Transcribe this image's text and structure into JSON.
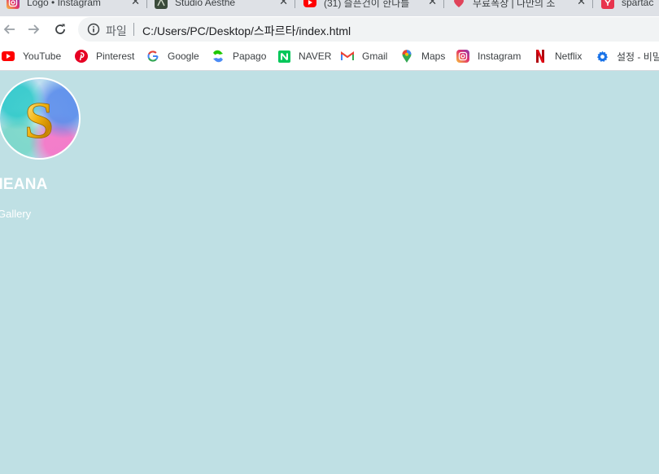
{
  "browser": {
    "tabs": [
      {
        "title": "Logo • Instagram",
        "icon": "instagram-icon"
      },
      {
        "title": "Studio Aesthe",
        "icon": "studio-aesthe-icon"
      },
      {
        "title": "(31) 슬픈건이 한다를",
        "icon": "youtube-icon"
      },
      {
        "title": "무료폭장 | 나만의 조",
        "icon": "heart-site-icon"
      },
      {
        "title": "spartac",
        "icon": "sparta-icon"
      }
    ],
    "tab_close_glyph": "✕",
    "address": {
      "label": "파일",
      "url": "C:/Users/PC/Desktop/스파르타/index.html"
    },
    "bookmarks": [
      {
        "label": "YouTube",
        "icon": "youtube-icon"
      },
      {
        "label": "Pinterest",
        "icon": "pinterest-icon"
      },
      {
        "label": "Google",
        "icon": "google-icon"
      },
      {
        "label": "Papago",
        "icon": "papago-icon"
      },
      {
        "label": "NAVER",
        "icon": "naver-icon"
      },
      {
        "label": "Gmail",
        "icon": "gmail-icon"
      },
      {
        "label": "Maps",
        "icon": "maps-icon"
      },
      {
        "label": "Instagram",
        "icon": "instagram-icon"
      },
      {
        "label": "Netflix",
        "icon": "netflix-icon"
      },
      {
        "label": "설정 - 비밀",
        "icon": "settings-gear-icon"
      }
    ]
  },
  "page": {
    "logo_letter": "S",
    "site_name": "HEANA",
    "nav_link": "Gallery",
    "background_color": "#bfe0e4"
  }
}
